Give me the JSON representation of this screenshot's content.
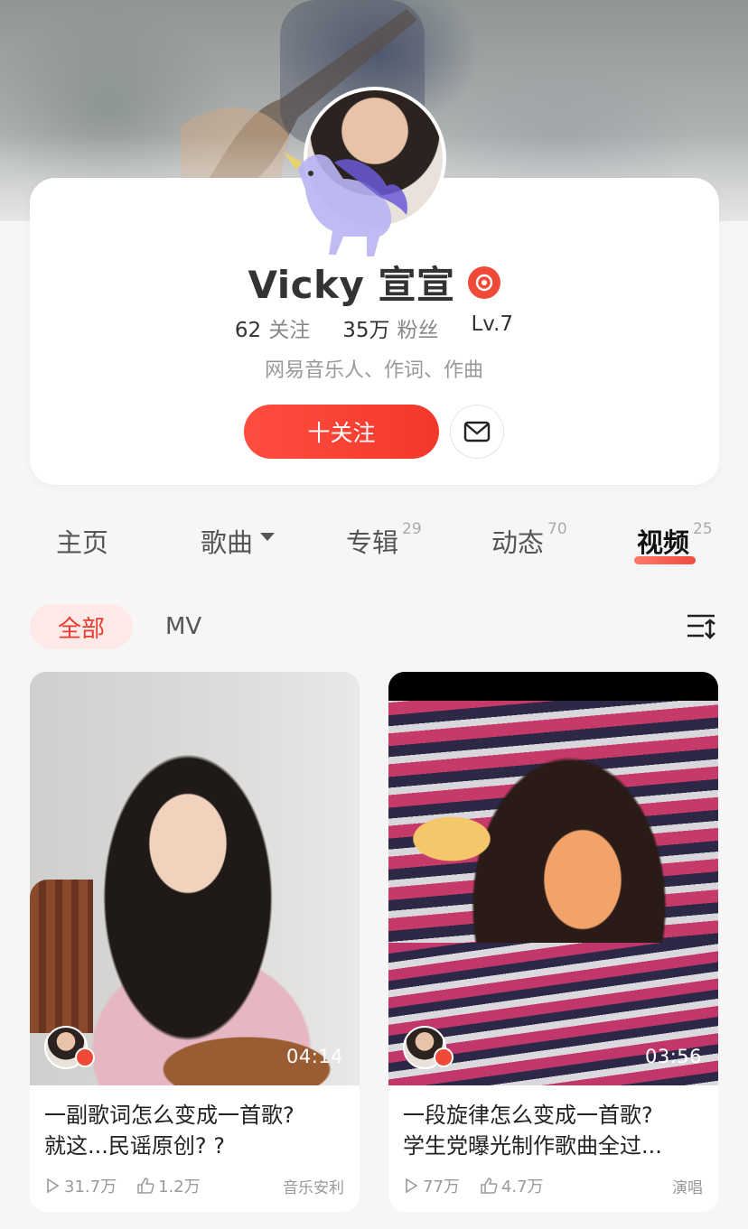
{
  "profile": {
    "name": "Vicky 宣宣",
    "following_count": "62",
    "following_label": "关注",
    "followers_count": "35万",
    "followers_label": "粉丝",
    "level": "Lv.7",
    "bio": "网易音乐人、作词、作曲",
    "follow_button": "十关注"
  },
  "tabs": [
    {
      "label": "主页",
      "count": ""
    },
    {
      "label": "歌曲",
      "count": ""
    },
    {
      "label": "专辑",
      "count": "29"
    },
    {
      "label": "动态",
      "count": "70"
    },
    {
      "label": "视频",
      "count": "25"
    }
  ],
  "active_tab": "视频",
  "filters": {
    "all": "全部",
    "mv": "MV"
  },
  "videos": [
    {
      "duration": "04:14",
      "title_line1": "一副歌词怎么变成一首歌?",
      "title_line2": "就这...民谣原创? ?",
      "plays": "31.7万",
      "likes": "1.2万",
      "tag": "音乐安利"
    },
    {
      "duration": "03:56",
      "title_line1": "一段旋律怎么变成一首歌?",
      "title_line2": "学生党曝光制作歌曲全过...",
      "plays": "77万",
      "likes": "4.7万",
      "tag": "演唱"
    }
  ],
  "colors": {
    "accent": "#f0382b",
    "accent_light": "#fde9e7",
    "badge": "#ef4a37"
  },
  "icons": {
    "music_badge": "music-badge-icon",
    "mail": "mail-icon",
    "dropdown": "caret-down-icon",
    "sort": "sort-icon",
    "play": "play-icon",
    "like": "thumb-up-icon"
  }
}
